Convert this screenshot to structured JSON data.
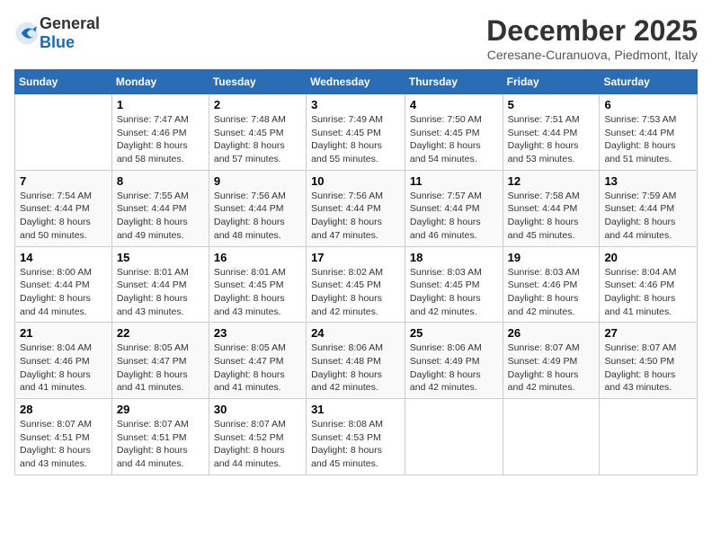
{
  "logo": {
    "general": "General",
    "blue": "Blue"
  },
  "title": "December 2025",
  "subtitle": "Ceresane-Curanuova, Piedmont, Italy",
  "weekdays": [
    "Sunday",
    "Monday",
    "Tuesday",
    "Wednesday",
    "Thursday",
    "Friday",
    "Saturday"
  ],
  "weeks": [
    [
      {
        "day": "",
        "sunrise": "",
        "sunset": "",
        "daylight": ""
      },
      {
        "day": "1",
        "sunrise": "Sunrise: 7:47 AM",
        "sunset": "Sunset: 4:46 PM",
        "daylight": "Daylight: 8 hours and 58 minutes."
      },
      {
        "day": "2",
        "sunrise": "Sunrise: 7:48 AM",
        "sunset": "Sunset: 4:45 PM",
        "daylight": "Daylight: 8 hours and 57 minutes."
      },
      {
        "day": "3",
        "sunrise": "Sunrise: 7:49 AM",
        "sunset": "Sunset: 4:45 PM",
        "daylight": "Daylight: 8 hours and 55 minutes."
      },
      {
        "day": "4",
        "sunrise": "Sunrise: 7:50 AM",
        "sunset": "Sunset: 4:45 PM",
        "daylight": "Daylight: 8 hours and 54 minutes."
      },
      {
        "day": "5",
        "sunrise": "Sunrise: 7:51 AM",
        "sunset": "Sunset: 4:44 PM",
        "daylight": "Daylight: 8 hours and 53 minutes."
      },
      {
        "day": "6",
        "sunrise": "Sunrise: 7:53 AM",
        "sunset": "Sunset: 4:44 PM",
        "daylight": "Daylight: 8 hours and 51 minutes."
      }
    ],
    [
      {
        "day": "7",
        "sunrise": "Sunrise: 7:54 AM",
        "sunset": "Sunset: 4:44 PM",
        "daylight": "Daylight: 8 hours and 50 minutes."
      },
      {
        "day": "8",
        "sunrise": "Sunrise: 7:55 AM",
        "sunset": "Sunset: 4:44 PM",
        "daylight": "Daylight: 8 hours and 49 minutes."
      },
      {
        "day": "9",
        "sunrise": "Sunrise: 7:56 AM",
        "sunset": "Sunset: 4:44 PM",
        "daylight": "Daylight: 8 hours and 48 minutes."
      },
      {
        "day": "10",
        "sunrise": "Sunrise: 7:56 AM",
        "sunset": "Sunset: 4:44 PM",
        "daylight": "Daylight: 8 hours and 47 minutes."
      },
      {
        "day": "11",
        "sunrise": "Sunrise: 7:57 AM",
        "sunset": "Sunset: 4:44 PM",
        "daylight": "Daylight: 8 hours and 46 minutes."
      },
      {
        "day": "12",
        "sunrise": "Sunrise: 7:58 AM",
        "sunset": "Sunset: 4:44 PM",
        "daylight": "Daylight: 8 hours and 45 minutes."
      },
      {
        "day": "13",
        "sunrise": "Sunrise: 7:59 AM",
        "sunset": "Sunset: 4:44 PM",
        "daylight": "Daylight: 8 hours and 44 minutes."
      }
    ],
    [
      {
        "day": "14",
        "sunrise": "Sunrise: 8:00 AM",
        "sunset": "Sunset: 4:44 PM",
        "daylight": "Daylight: 8 hours and 44 minutes."
      },
      {
        "day": "15",
        "sunrise": "Sunrise: 8:01 AM",
        "sunset": "Sunset: 4:44 PM",
        "daylight": "Daylight: 8 hours and 43 minutes."
      },
      {
        "day": "16",
        "sunrise": "Sunrise: 8:01 AM",
        "sunset": "Sunset: 4:45 PM",
        "daylight": "Daylight: 8 hours and 43 minutes."
      },
      {
        "day": "17",
        "sunrise": "Sunrise: 8:02 AM",
        "sunset": "Sunset: 4:45 PM",
        "daylight": "Daylight: 8 hours and 42 minutes."
      },
      {
        "day": "18",
        "sunrise": "Sunrise: 8:03 AM",
        "sunset": "Sunset: 4:45 PM",
        "daylight": "Daylight: 8 hours and 42 minutes."
      },
      {
        "day": "19",
        "sunrise": "Sunrise: 8:03 AM",
        "sunset": "Sunset: 4:46 PM",
        "daylight": "Daylight: 8 hours and 42 minutes."
      },
      {
        "day": "20",
        "sunrise": "Sunrise: 8:04 AM",
        "sunset": "Sunset: 4:46 PM",
        "daylight": "Daylight: 8 hours and 41 minutes."
      }
    ],
    [
      {
        "day": "21",
        "sunrise": "Sunrise: 8:04 AM",
        "sunset": "Sunset: 4:46 PM",
        "daylight": "Daylight: 8 hours and 41 minutes."
      },
      {
        "day": "22",
        "sunrise": "Sunrise: 8:05 AM",
        "sunset": "Sunset: 4:47 PM",
        "daylight": "Daylight: 8 hours and 41 minutes."
      },
      {
        "day": "23",
        "sunrise": "Sunrise: 8:05 AM",
        "sunset": "Sunset: 4:47 PM",
        "daylight": "Daylight: 8 hours and 41 minutes."
      },
      {
        "day": "24",
        "sunrise": "Sunrise: 8:06 AM",
        "sunset": "Sunset: 4:48 PM",
        "daylight": "Daylight: 8 hours and 42 minutes."
      },
      {
        "day": "25",
        "sunrise": "Sunrise: 8:06 AM",
        "sunset": "Sunset: 4:49 PM",
        "daylight": "Daylight: 8 hours and 42 minutes."
      },
      {
        "day": "26",
        "sunrise": "Sunrise: 8:07 AM",
        "sunset": "Sunset: 4:49 PM",
        "daylight": "Daylight: 8 hours and 42 minutes."
      },
      {
        "day": "27",
        "sunrise": "Sunrise: 8:07 AM",
        "sunset": "Sunset: 4:50 PM",
        "daylight": "Daylight: 8 hours and 43 minutes."
      }
    ],
    [
      {
        "day": "28",
        "sunrise": "Sunrise: 8:07 AM",
        "sunset": "Sunset: 4:51 PM",
        "daylight": "Daylight: 8 hours and 43 minutes."
      },
      {
        "day": "29",
        "sunrise": "Sunrise: 8:07 AM",
        "sunset": "Sunset: 4:51 PM",
        "daylight": "Daylight: 8 hours and 44 minutes."
      },
      {
        "day": "30",
        "sunrise": "Sunrise: 8:07 AM",
        "sunset": "Sunset: 4:52 PM",
        "daylight": "Daylight: 8 hours and 44 minutes."
      },
      {
        "day": "31",
        "sunrise": "Sunrise: 8:08 AM",
        "sunset": "Sunset: 4:53 PM",
        "daylight": "Daylight: 8 hours and 45 minutes."
      },
      {
        "day": "",
        "sunrise": "",
        "sunset": "",
        "daylight": ""
      },
      {
        "day": "",
        "sunrise": "",
        "sunset": "",
        "daylight": ""
      },
      {
        "day": "",
        "sunrise": "",
        "sunset": "",
        "daylight": ""
      }
    ]
  ]
}
